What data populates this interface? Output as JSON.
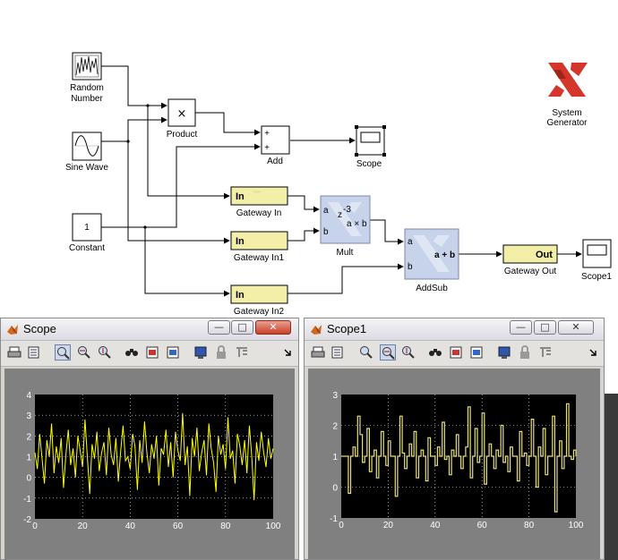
{
  "blocks": {
    "random_number": [
      "Random",
      "Number"
    ],
    "sine_wave": "Sine Wave",
    "constant": "Constant",
    "constant_value": "1",
    "product": "Product",
    "product_symbol": "×",
    "add": "Add",
    "add_plus": "+",
    "scope": "Scope",
    "gateway_in": "Gateway In",
    "gateway_in1": "Gateway In1",
    "gateway_in2": "Gateway In2",
    "gateway_in_text": "In",
    "mult": "Mult",
    "mult_port_a": "a",
    "mult_port_b": "b",
    "mult_delay_z": "z",
    "mult_delay_exp": "-3",
    "mult_expr": "a × b",
    "addsub": "AddSub",
    "addsub_port_a": "a",
    "addsub_port_b": "b",
    "addsub_expr": "a + b",
    "gateway_out": "Gateway Out",
    "gateway_out_text": "Out",
    "scope1": "Scope1",
    "system_generator": [
      "System",
      "Generator"
    ]
  },
  "colors": {
    "gateway_fill": "#f3efa8",
    "xilinx_block_fill": "#c6d3ea",
    "xilinx_logo_red": "#d4362b",
    "trace_left": "#ffff00",
    "trace_right": "#e8e07a",
    "plot_bg": "#000000",
    "window_bg": "#d6d3ce"
  },
  "scope_window": {
    "title": "Scope",
    "buttons": {
      "minimize": "—",
      "maximize": "□",
      "close": "✕"
    }
  },
  "scope1_window": {
    "title": "Scope1",
    "buttons": {
      "minimize": "—",
      "maximize": "□",
      "close": "✕"
    }
  },
  "toolbar_icons": [
    "print-icon",
    "parameters-icon",
    "zoom-icon",
    "zoom-x-icon",
    "zoom-y-icon",
    "autoscale-icon",
    "save-axes-icon",
    "restore-axes-icon",
    "floating-scope-icon",
    "lock-axes-icon",
    "signal-selector-icon",
    "dock-arrow-icon"
  ],
  "chart_data": [
    {
      "type": "line",
      "title": "",
      "xlabel": "",
      "ylabel": "",
      "xlim": [
        0,
        100
      ],
      "ylim": [
        -2,
        4
      ],
      "xticks": [
        "0",
        "20",
        "40",
        "60",
        "80",
        "100"
      ],
      "yticks": [
        "4",
        "3",
        "2",
        "1",
        "0",
        "-1",
        "-2"
      ],
      "grid": true,
      "series": [
        {
          "x_range": [
            0,
            100
          ],
          "values": [
            1.2,
            0.4,
            2.1,
            0.9,
            -0.3,
            1.8,
            1.0,
            2.6,
            0.2,
            1.5,
            0.7,
            1.9,
            -0.5,
            1.1,
            2.3,
            0.6,
            1.4,
            0.0,
            2.0,
            1.3,
            0.5,
            2.8,
            1.0,
            -0.8,
            1.6,
            0.9,
            2.2,
            0.3,
            1.2,
            1.7,
            0.1,
            2.4,
            1.1,
            0.6,
            1.9,
            -0.2,
            1.3,
            2.5,
            0.8,
            1.0,
            0.4,
            2.1,
            1.5,
            -0.6,
            1.8,
            0.7,
            2.7,
            1.2,
            0.2,
            1.6,
            0.9,
            2.0,
            -0.4,
            1.4,
            1.1,
            2.3,
            0.5,
            1.7,
            0.0,
            2.2,
            1.3,
            0.8,
            3.1,
            0.6,
            1.5,
            -0.9,
            1.9,
            1.0,
            2.4,
            0.3,
            1.2,
            1.8,
            0.1,
            2.6,
            1.4,
            0.7,
            -0.7,
            2.0,
            1.1,
            1.6,
            0.4,
            2.9,
            0.9,
            1.3,
            -0.3,
            2.1,
            1.5,
            0.6,
            1.8,
            0.2,
            2.5,
            1.0,
            -1.1,
            1.7,
            0.8,
            2.2,
            1.2,
            0.5,
            1.9,
            0.9,
            1.4
          ]
        }
      ]
    },
    {
      "type": "line",
      "title": "",
      "xlabel": "",
      "ylabel": "",
      "xlim": [
        0,
        100
      ],
      "ylim": [
        -1,
        3
      ],
      "xticks": [
        "0",
        "20",
        "40",
        "60",
        "80",
        "100"
      ],
      "yticks": [
        "3",
        "2",
        "1",
        "0",
        "-1"
      ],
      "grid": true,
      "step": true,
      "series": [
        {
          "x_range": [
            0,
            100
          ],
          "values": [
            1.0,
            1.0,
            1.0,
            -0.2,
            1.0,
            1.3,
            1.0,
            2.3,
            1.7,
            0.8,
            1.0,
            1.9,
            0.5,
            1.0,
            1.2,
            0.3,
            1.0,
            1.8,
            1.0,
            0.7,
            1.5,
            1.0,
            1.0,
            -0.3,
            1.0,
            2.3,
            1.1,
            0.6,
            1.0,
            1.4,
            1.0,
            1.8,
            0.3,
            1.0,
            1.2,
            1.0,
            0.2,
            1.6,
            1.0,
            1.0,
            0.7,
            1.3,
            1.0,
            2.1,
            0.9,
            1.0,
            0.4,
            1.2,
            1.0,
            1.7,
            1.0,
            0.6,
            1.0,
            1.3,
            2.6,
            0.3,
            1.0,
            1.9,
            0.8,
            1.0,
            2.4,
            0.1,
            1.0,
            1.4,
            1.0,
            0.6,
            1.2,
            1.0,
            2.0,
            0.8,
            1.0,
            0.5,
            1.3,
            1.0,
            1.0,
            0.2,
            1.8,
            1.0,
            1.1,
            0.7,
            1.0,
            2.2,
            1.0,
            0.0,
            1.3,
            1.0,
            1.9,
            0.4,
            1.0,
            1.0,
            2.3,
            -0.8,
            1.0,
            1.5,
            0.6,
            1.0,
            2.7,
            1.0,
            0.9,
            1.2,
            1.0
          ]
        }
      ]
    }
  ]
}
